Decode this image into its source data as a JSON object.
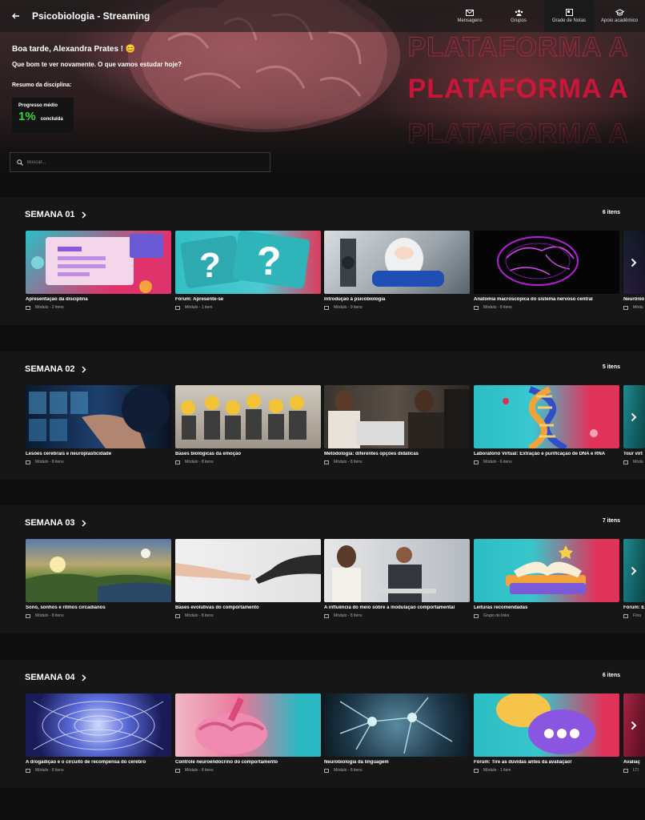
{
  "header": {
    "title": "Psicobiologia - Streaming",
    "nav": [
      {
        "label": "Mensagens",
        "icon": "mail-icon"
      },
      {
        "label": "Grupos",
        "icon": "users-icon"
      },
      {
        "label": "Grade de Notas",
        "icon": "grid-icon",
        "active": true
      },
      {
        "label": "Apoio acadêmico",
        "icon": "graduation-cap-icon"
      }
    ]
  },
  "hero": {
    "greeting": "Boa tarde, Alexandra Prates ! 😊",
    "subtitle": "Que bom te ver novamente. O que vamos estudar hoje?",
    "summary_label": "Resumo da disciplina:",
    "watermark": "PLATAFORMA A",
    "progress": {
      "label": "Progresso médio",
      "value": "1%",
      "suffix": "concluída"
    }
  },
  "search": {
    "placeholder": "Buscar..."
  },
  "weeks": [
    {
      "title": "SEMANA 01",
      "count": "6 itens",
      "cards": [
        {
          "title": "Apresentação da disciplina",
          "meta": "Módulo - 2 itens"
        },
        {
          "title": "Fórum: Apresente-se",
          "meta": "Módulo - 1 item"
        },
        {
          "title": "Introdução à psicobiologia",
          "meta": "Módulo - 9 itens"
        },
        {
          "title": "Anatomia macroscópica do sistema nervoso central",
          "meta": "Módulo - 8 itens"
        },
        {
          "title": "Neurônio",
          "meta": "Módu"
        }
      ]
    },
    {
      "title": "SEMANA 02",
      "count": "5 itens",
      "cards": [
        {
          "title": "Lesões cerebrais e neuroplasticidade",
          "meta": "Módulo - 8 itens"
        },
        {
          "title": "Bases biológicas da emoção",
          "meta": "Módulo - 8 itens"
        },
        {
          "title": "Metodologia: diferentes opções didáticas",
          "meta": "Módulo - 8 itens"
        },
        {
          "title": "Laboratório Virtual: Extração e purificação de DNA e RNA",
          "meta": "Módulo - 6 itens"
        },
        {
          "title": "Tour virt",
          "meta": "Módu"
        }
      ]
    },
    {
      "title": "SEMANA 03",
      "count": "7 itens",
      "cards": [
        {
          "title": "Sono, sonhos e ritmos circadianos",
          "meta": "Módulo - 8 itens"
        },
        {
          "title": "Bases evolutivas do comportamento",
          "meta": "Módulo - 8 itens"
        },
        {
          "title": "A influência do meio sobre a modulação comportamental",
          "meta": "Módulo - 8 itens"
        },
        {
          "title": "Leituras recomendadas",
          "meta": "Grupo de links"
        },
        {
          "title": "Fórum: E",
          "meta": "Fóru"
        }
      ]
    },
    {
      "title": "SEMANA 04",
      "count": "6 itens",
      "cards": [
        {
          "title": "A drogadição e o circuito de recompensa do cérebro",
          "meta": "Módulo - 8 itens"
        },
        {
          "title": "Controle neuroendócrino do comportamento",
          "meta": "Módulo - 8 itens"
        },
        {
          "title": "Neurobiologia da linguagem",
          "meta": "Módulo - 8 itens"
        },
        {
          "title": "Fórum: Tire as dúvidas antes da avaliação!",
          "meta": "Módulo - 1 item"
        },
        {
          "title": "Avaliaç",
          "meta": "LTI"
        }
      ]
    }
  ]
}
